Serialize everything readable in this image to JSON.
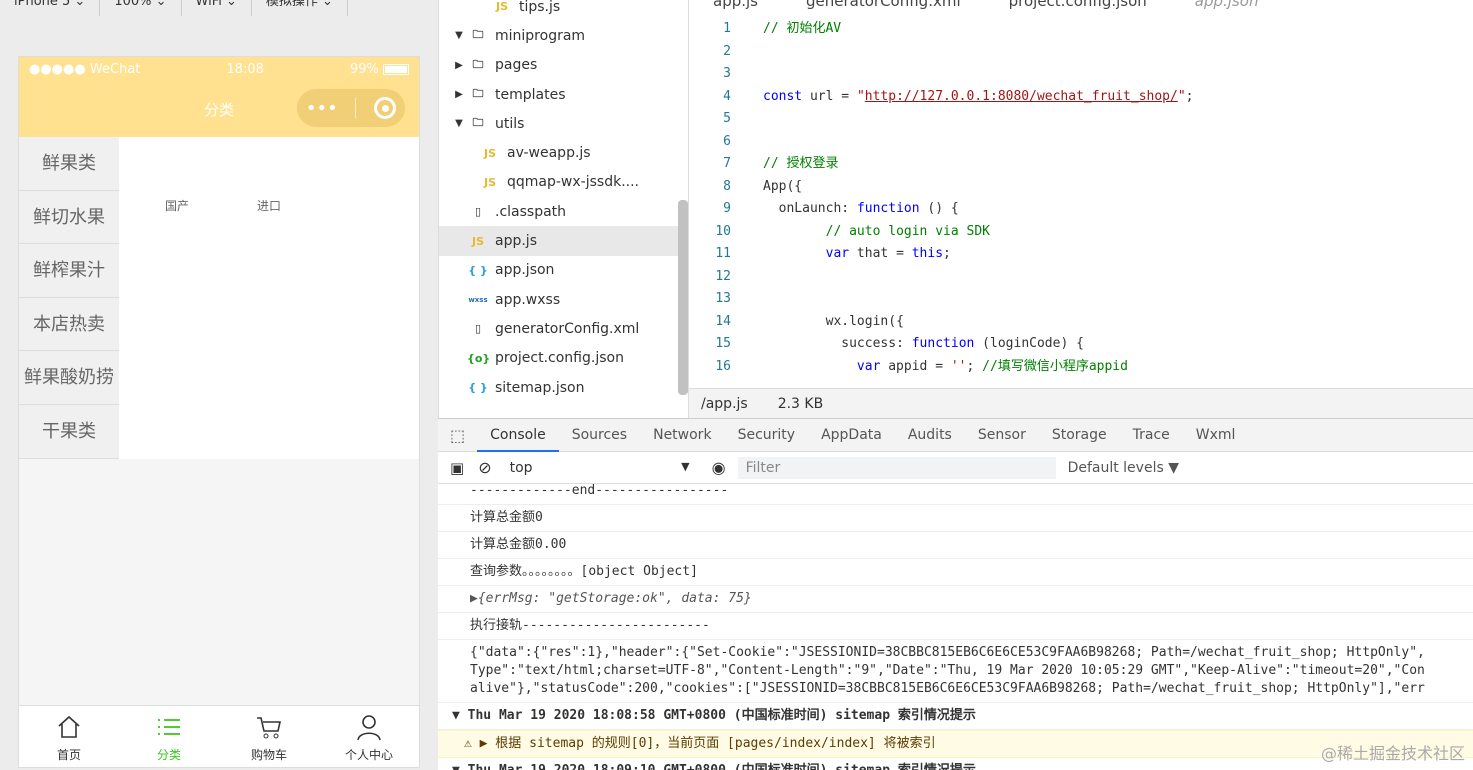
{
  "simulator": {
    "toolbar": [
      "iPhone 5",
      "100%",
      "WiFi",
      "模拟操作"
    ],
    "status": {
      "carrier": "●●●●● WeChat",
      "time": "18:08",
      "battery": "99%"
    },
    "nav_title": "分类",
    "capsule_more": "•••",
    "categories": [
      "鲜果类",
      "鲜切水果",
      "鲜榨果汁",
      "本店热卖",
      "鲜果酸奶捞",
      "干果类"
    ],
    "sub_categories": [
      "国产",
      "进口"
    ],
    "tabbar": [
      {
        "label": "首页",
        "icon": "home-icon"
      },
      {
        "label": "分类",
        "icon": "list-icon"
      },
      {
        "label": "购物车",
        "icon": "cart-icon"
      },
      {
        "label": "个人中心",
        "icon": "user-icon"
      }
    ],
    "active_tab": 1,
    "accent": "#ffe18f",
    "tab_active_color": "#3cc51f"
  },
  "files": {
    "items": [
      {
        "type": "js",
        "name": "tips.js",
        "indent": 2,
        "expand": ""
      },
      {
        "type": "folder",
        "name": "miniprogram",
        "indent": 0,
        "expand": "▼"
      },
      {
        "type": "folder",
        "name": "pages",
        "indent": 0,
        "expand": "▶"
      },
      {
        "type": "folder",
        "name": "templates",
        "indent": 0,
        "expand": "▶"
      },
      {
        "type": "folder",
        "name": "utils",
        "indent": 0,
        "expand": "▼"
      },
      {
        "type": "js",
        "name": "av-weapp.js",
        "indent": 1,
        "expand": ""
      },
      {
        "type": "js",
        "name": "qqmap-wx-jssdk....",
        "indent": 1,
        "expand": ""
      },
      {
        "type": "file",
        "name": ".classpath",
        "indent": 0,
        "expand": ""
      },
      {
        "type": "js",
        "name": "app.js",
        "indent": 0,
        "expand": "",
        "selected": true
      },
      {
        "type": "json",
        "name": "app.json",
        "indent": 0,
        "expand": ""
      },
      {
        "type": "wxss",
        "name": "app.wxss",
        "indent": 0,
        "expand": ""
      },
      {
        "type": "file",
        "name": "generatorConfig.xml",
        "indent": 0,
        "expand": ""
      },
      {
        "type": "cfg",
        "name": "project.config.json",
        "indent": 0,
        "expand": ""
      },
      {
        "type": "json",
        "name": "sitemap.json",
        "indent": 0,
        "expand": ""
      }
    ]
  },
  "editor": {
    "tabs": [
      "app.js",
      "generatorConfig.xml",
      "project.config.json",
      "app.json"
    ],
    "status_path": "/app.js",
    "status_size": "2.3 KB",
    "lines": [
      {
        "n": "1",
        "indent": "",
        "parts": [
          {
            "c": "cm",
            "t": "// 初始化AV"
          }
        ]
      },
      {
        "n": "2",
        "indent": "",
        "parts": []
      },
      {
        "n": "3",
        "indent": "",
        "parts": []
      },
      {
        "n": "4",
        "indent": "",
        "parts": [
          {
            "c": "kw",
            "t": "const"
          },
          {
            "c": "",
            "t": " url = "
          },
          {
            "c": "str",
            "t": "\""
          },
          {
            "c": "url",
            "t": "http://127.0.0.1:8080/wechat_fruit_shop/"
          },
          {
            "c": "str",
            "t": "\""
          },
          {
            "c": "",
            "t": ";"
          }
        ]
      },
      {
        "n": "5",
        "indent": "",
        "parts": []
      },
      {
        "n": "6",
        "indent": "",
        "parts": []
      },
      {
        "n": "7",
        "indent": "",
        "parts": [
          {
            "c": "cm",
            "t": "// 授权登录"
          }
        ]
      },
      {
        "n": "8",
        "indent": "",
        "parts": [
          {
            "c": "",
            "t": "App({"
          }
        ]
      },
      {
        "n": "9",
        "indent": "  ",
        "parts": [
          {
            "c": "",
            "t": "onLaunch: "
          },
          {
            "c": "kw",
            "t": "function"
          },
          {
            "c": "",
            "t": " () {"
          }
        ]
      },
      {
        "n": "10",
        "indent": "        ",
        "parts": [
          {
            "c": "cm",
            "t": "// auto login via SDK"
          }
        ]
      },
      {
        "n": "11",
        "indent": "        ",
        "parts": [
          {
            "c": "kw",
            "t": "var"
          },
          {
            "c": "",
            "t": " that = "
          },
          {
            "c": "kw",
            "t": "this"
          },
          {
            "c": "",
            "t": ";"
          }
        ]
      },
      {
        "n": "12",
        "indent": "",
        "parts": []
      },
      {
        "n": "13",
        "indent": "",
        "parts": []
      },
      {
        "n": "14",
        "indent": "        ",
        "parts": [
          {
            "c": "",
            "t": "wx.login({"
          }
        ]
      },
      {
        "n": "15",
        "indent": "          ",
        "parts": [
          {
            "c": "",
            "t": "success: "
          },
          {
            "c": "kw",
            "t": "function"
          },
          {
            "c": "",
            "t": " (loginCode) {"
          }
        ]
      },
      {
        "n": "16",
        "indent": "            ",
        "parts": [
          {
            "c": "kw",
            "t": "var"
          },
          {
            "c": "",
            "t": " appid = "
          },
          {
            "c": "str",
            "t": "''"
          },
          {
            "c": "",
            "t": "; "
          },
          {
            "c": "cm",
            "t": "//填写微信小程序appid"
          }
        ]
      }
    ]
  },
  "devtools": {
    "tabs": [
      "Console",
      "Sources",
      "Network",
      "Security",
      "AppData",
      "Audits",
      "Sensor",
      "Storage",
      "Trace",
      "Wxml"
    ],
    "active_tab": 0,
    "context": "top",
    "filter_placeholder": "Filter",
    "levels": "Default levels ▼",
    "messages": [
      {
        "kind": "log",
        "text": "-------------end-----------------"
      },
      {
        "kind": "log",
        "text": "计算总金额0"
      },
      {
        "kind": "log",
        "text": "计算总金额0.00"
      },
      {
        "kind": "log",
        "text": "查询参数。。。。。。。。[object Object]"
      },
      {
        "kind": "obj",
        "text": "▶{errMsg: \"getStorage:ok\", data: 75}"
      },
      {
        "kind": "log",
        "text": "执行接轨------------------------"
      },
      {
        "kind": "log",
        "text": "{\"data\":{\"res\":1},\"header\":{\"Set-Cookie\":\"JSESSIONID=38CBBC815EB6C6E6CE53C9FAA6B98268; Path=/wechat_fruit_shop; HttpOnly\",\nType\":\"text/html;charset=UTF-8\",\"Content-Length\":\"9\",\"Date\":\"Thu, 19 Mar 2020 10:05:29 GMT\",\"Keep-Alive\":\"timeout=20\",\"Con\nalive\"},\"statusCode\":200,\"cookies\":[\"JSESSIONID=38CBBC815EB6C6E6CE53C9FAA6B98268; Path=/wechat_fruit_shop; HttpOnly\"],\"err"
      },
      {
        "kind": "grp",
        "text": "▼ Thu Mar 19 2020 18:08:58 GMT+0800 (中国标准时间) sitemap 索引情况提示"
      },
      {
        "kind": "warn",
        "text": "⚠ ▶ 根据 sitemap 的规则[0]，当前页面 [pages/index/index] 将被索引"
      },
      {
        "kind": "grp",
        "text": "▼ Thu Mar 19 2020 18:09:10 GMT+0800 (中国标准时间) sitemap 索引情况提示"
      }
    ]
  },
  "watermark": "@稀土掘金技术社区"
}
